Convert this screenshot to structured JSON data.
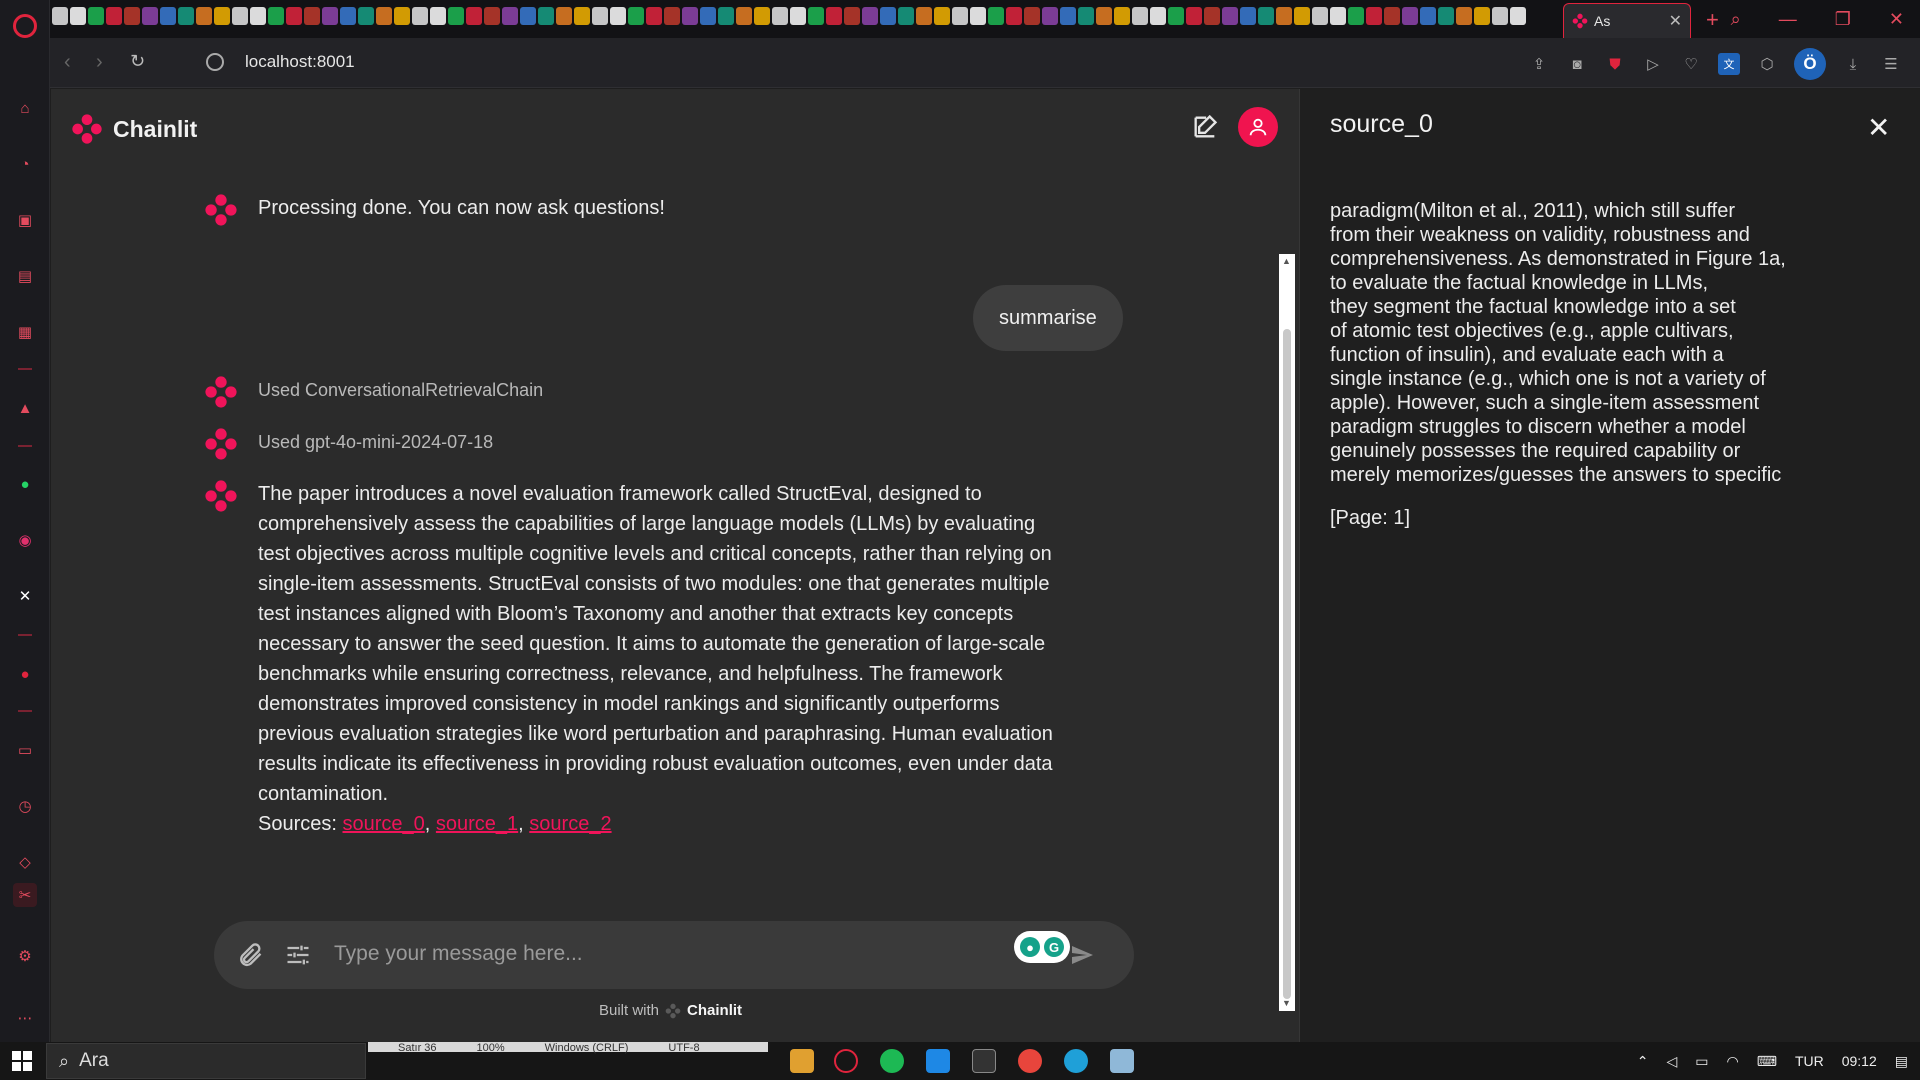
{
  "browser": {
    "active_tab_title": "As",
    "url": "localhost:8001",
    "profile_initial": "Ö"
  },
  "app": {
    "brand": "Chainlit",
    "accent_color": "#f0145a"
  },
  "messages": {
    "processing_done": "Processing done. You can now ask questions!",
    "user_message": "summarise",
    "step_1": "Used ConversationalRetrievalChain",
    "step_2": "Used gpt-4o-mini-2024-07-18",
    "answer_lines": [
      "The paper introduces a novel evaluation framework called StructEval, designed to",
      "comprehensively assess the capabilities of large language models (LLMs) by evaluating",
      "test objectives across multiple cognitive levels and critical concepts, rather than relying on",
      "single-item assessments. StructEval consists of two modules: one that generates multiple",
      "test instances aligned with Bloom’s Taxonomy and another that extracts key concepts",
      "necessary to answer the seed question. It aims to automate the generation of large-scale",
      "benchmarks while ensuring correctness, relevance, and helpfulness. The framework",
      "demonstrates improved consistency in model rankings and significantly outperforms",
      "previous evaluation strategies like word perturbation and paraphrasing. Human evaluation",
      "results indicate its effectiveness in providing robust evaluation outcomes, even under data",
      "contamination."
    ],
    "sources_label": "Sources: ",
    "sources": [
      "source_0",
      "source_1",
      "source_2"
    ],
    "comma": ", "
  },
  "composer": {
    "placeholder": "Type your message here..."
  },
  "footer": {
    "built_with": "Built with",
    "brand": "Chainlit"
  },
  "panel": {
    "title": "source_0",
    "lines": [
      "paradigm(Milton et al., 2011), which still suffer",
      "from their weakness on validity, robustness and",
      "comprehensiveness. As demonstrated in Figure 1a,",
      "to evaluate the factual knowledge in LLMs,",
      "they segment the factual knowledge into a set",
      "of atomic test objectives (e.g., apple cultivars,",
      "function of insulin), and evaluate each with a",
      "single instance (e.g., which one is not a variety of",
      "apple). However, such a single-item assessment",
      "paradigm struggles to discern whether a model",
      "genuinely possesses the required capability or",
      "merely memorizes/guesses the answers to specific"
    ],
    "page": "[Page: 1]"
  },
  "taskbar": {
    "search_label": "Ara",
    "strip_items": [
      "Satır 36",
      "100%",
      "Windows (CRLF)",
      "UTF-8"
    ],
    "language": "TUR",
    "time": "09:12"
  }
}
